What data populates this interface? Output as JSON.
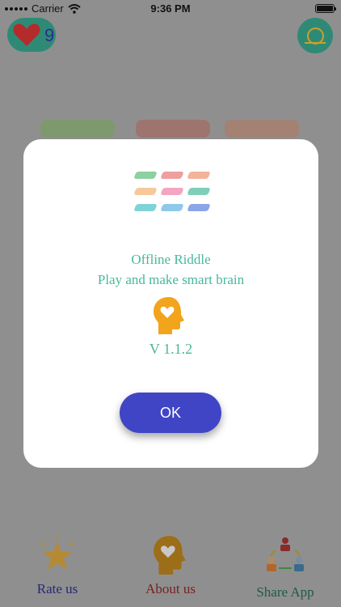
{
  "status_bar": {
    "carrier": "Carrier",
    "time": "9:36 PM"
  },
  "header": {
    "hearts_count": "9"
  },
  "modal": {
    "title": "Offline Riddle",
    "subtitle": "Play and make smart brain",
    "version": "V 1.1.2",
    "ok_label": "OK",
    "tile_colors": [
      "#8dd0a2",
      "#ef9f9f",
      "#f2b39a",
      "#f6c99c",
      "#f2a6c2",
      "#7fcfb8",
      "#7fd3d8",
      "#8ec9ec",
      "#8aa6e8"
    ]
  },
  "bottom_nav": {
    "rate_label": "Rate us",
    "about_label": "About us",
    "share_label": "Share App"
  },
  "colors": {
    "accent_teal": "#48b89a",
    "ok_button": "#4045c6",
    "overlay": "#8f8f8f"
  }
}
